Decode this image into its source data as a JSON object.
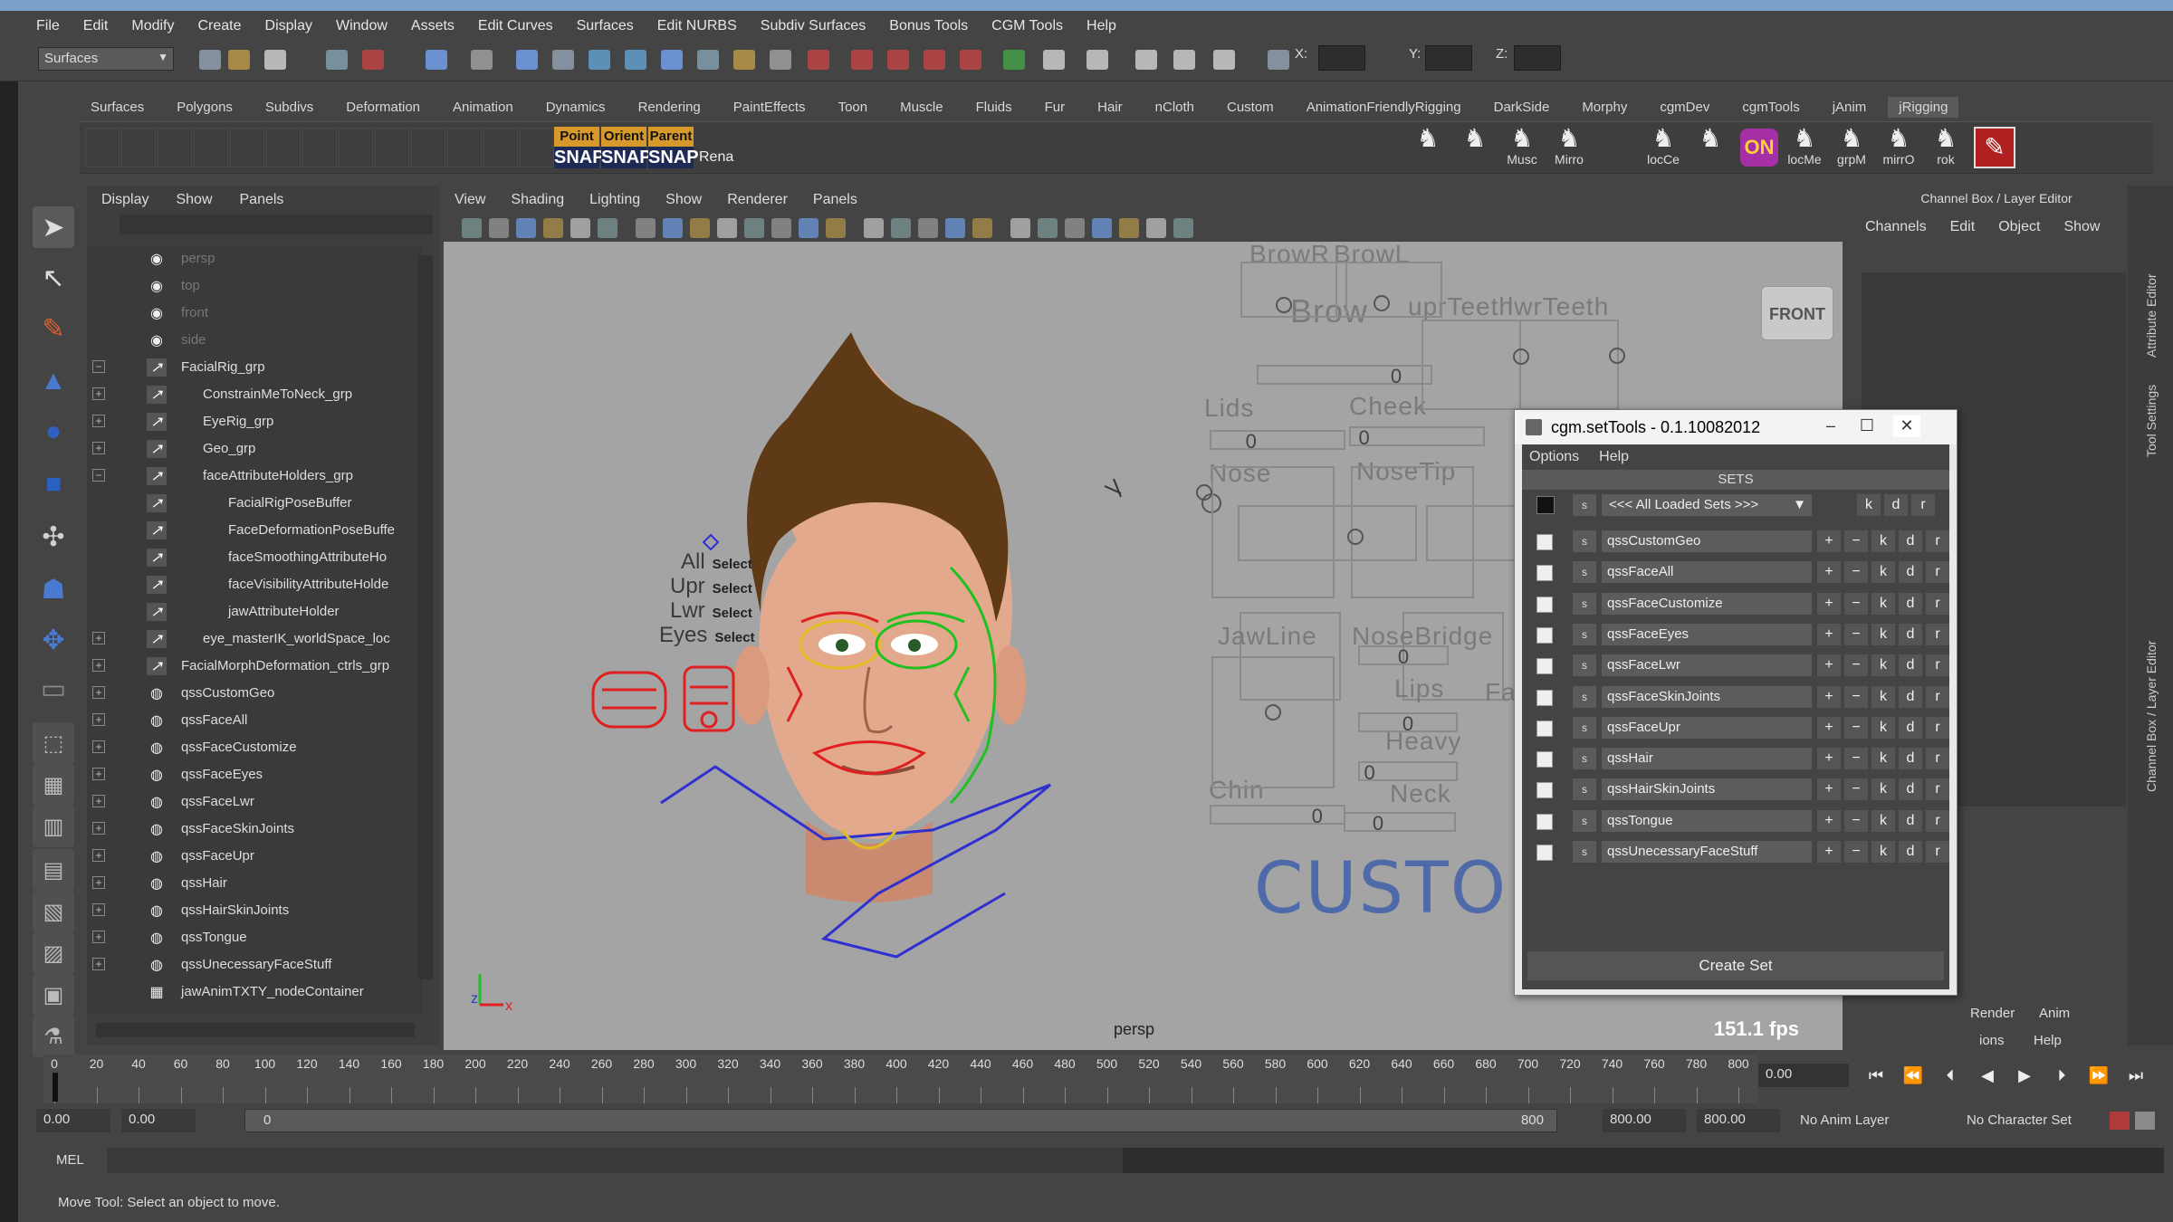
{
  "menubar": [
    "File",
    "Edit",
    "Modify",
    "Create",
    "Display",
    "Window",
    "Assets",
    "Edit Curves",
    "Surfaces",
    "Edit NURBS",
    "Subdiv Surfaces",
    "Bonus Tools",
    "CGM Tools",
    "Help"
  ],
  "status": {
    "mode": "Surfaces",
    "x_label": "X:",
    "y_label": "Y:",
    "z_label": "Z:"
  },
  "shelf_tabs": [
    "Surfaces",
    "Polygons",
    "Subdivs",
    "Deformation",
    "Animation",
    "Dynamics",
    "Rendering",
    "PaintEffects",
    "Toon",
    "Muscle",
    "Fluids",
    "Fur",
    "Hair",
    "nCloth",
    "Custom",
    "AnimationFriendlyRigging",
    "DarkSide",
    "Morphy",
    "cgmDev",
    "cgmTools",
    "jAnim",
    "jRigging"
  ],
  "snap": [
    {
      "top": "Point",
      "bottom": "SNAP"
    },
    {
      "top": "Orient",
      "bottom": "SNAP"
    },
    {
      "top": "Parent",
      "bottom": "SNAP"
    }
  ],
  "shelf_rena": "Rena",
  "shelf_right": [
    {
      "g": "⛓",
      "l": ""
    },
    {
      "g": "⛓",
      "l": ""
    },
    {
      "g": "⛓",
      "l": "Musc"
    },
    {
      "g": "⛓",
      "l": "Mirro"
    },
    {
      "g": "⛓",
      "l": "locCe"
    },
    {
      "g": "⛓",
      "l": ""
    },
    {
      "g": "⛓",
      "l": "locMe"
    },
    {
      "g": "⛓",
      "l": "grpM"
    },
    {
      "g": "⛓",
      "l": "mirrO"
    },
    {
      "g": "⛓",
      "l": "rok"
    }
  ],
  "on_label": "ON",
  "outliner": {
    "menu": [
      "Display",
      "Show",
      "Panels"
    ],
    "rows": [
      {
        "exp": "",
        "icon": "camera-icon",
        "label": "persp",
        "dim": true,
        "indent": 0
      },
      {
        "exp": "",
        "icon": "camera-icon",
        "label": "top",
        "dim": true,
        "indent": 0
      },
      {
        "exp": "",
        "icon": "camera-icon",
        "label": "front",
        "dim": true,
        "indent": 0
      },
      {
        "exp": "",
        "icon": "camera-icon",
        "label": "side",
        "dim": true,
        "indent": 0
      },
      {
        "exp": "−",
        "icon": "transform-icon",
        "label": "FacialRig_grp",
        "dim": false,
        "indent": 0
      },
      {
        "exp": "+",
        "icon": "transform-icon",
        "label": "ConstrainMeToNeck_grp",
        "dim": false,
        "indent": 1
      },
      {
        "exp": "+",
        "icon": "transform-icon",
        "label": "EyeRig_grp",
        "dim": false,
        "indent": 1
      },
      {
        "exp": "+",
        "icon": "transform-icon",
        "label": "Geo_grp",
        "dim": false,
        "indent": 1
      },
      {
        "exp": "−",
        "icon": "transform-icon",
        "label": "faceAttributeHolders_grp",
        "dim": false,
        "indent": 1
      },
      {
        "exp": "",
        "icon": "transform-icon",
        "label": "FacialRigPoseBuffer",
        "dim": false,
        "indent": 2
      },
      {
        "exp": "",
        "icon": "transform-icon",
        "label": "FaceDeformationPoseBuffe",
        "dim": false,
        "indent": 2
      },
      {
        "exp": "",
        "icon": "transform-icon",
        "label": "faceSmoothingAttributeHo",
        "dim": false,
        "indent": 2
      },
      {
        "exp": "",
        "icon": "transform-icon",
        "label": "faceVisibilityAttributeHolde",
        "dim": false,
        "indent": 2
      },
      {
        "exp": "",
        "icon": "transform-icon",
        "label": "jawAttributeHolder",
        "dim": false,
        "indent": 2
      },
      {
        "exp": "+",
        "icon": "transform-icon",
        "label": "eye_masterIK_worldSpace_loc",
        "dim": false,
        "indent": 1
      },
      {
        "exp": "+",
        "icon": "transform-icon",
        "label": "FacialMorphDeformation_ctrls_grp",
        "dim": false,
        "indent": 0
      },
      {
        "exp": "+",
        "icon": "set-icon",
        "label": "qssCustomGeo",
        "dim": false,
        "indent": 0
      },
      {
        "exp": "+",
        "icon": "set-icon",
        "label": "qssFaceAll",
        "dim": false,
        "indent": 0
      },
      {
        "exp": "+",
        "icon": "set-icon",
        "label": "qssFaceCustomize",
        "dim": false,
        "indent": 0
      },
      {
        "exp": "+",
        "icon": "set-icon",
        "label": "qssFaceEyes",
        "dim": false,
        "indent": 0
      },
      {
        "exp": "+",
        "icon": "set-icon",
        "label": "qssFaceLwr",
        "dim": false,
        "indent": 0
      },
      {
        "exp": "+",
        "icon": "set-icon",
        "label": "qssFaceSkinJoints",
        "dim": false,
        "indent": 0
      },
      {
        "exp": "+",
        "icon": "set-icon",
        "label": "qssFaceUpr",
        "dim": false,
        "indent": 0
      },
      {
        "exp": "+",
        "icon": "set-icon",
        "label": "qssHair",
        "dim": false,
        "indent": 0
      },
      {
        "exp": "+",
        "icon": "set-icon",
        "label": "qssHairSkinJoints",
        "dim": false,
        "indent": 0
      },
      {
        "exp": "+",
        "icon": "set-icon",
        "label": "qssTongue",
        "dim": false,
        "indent": 0
      },
      {
        "exp": "+",
        "icon": "set-icon",
        "label": "qssUnecessaryFaceStuff",
        "dim": false,
        "indent": 0
      },
      {
        "exp": "",
        "icon": "container-icon",
        "label": "jawAnimTXTY_nodeContainer",
        "dim": false,
        "indent": 0
      }
    ]
  },
  "viewport": {
    "menu": [
      "View",
      "Shading",
      "Lighting",
      "Show",
      "Renderer",
      "Panels"
    ],
    "camera": "persp",
    "fps": "151.1 fps",
    "front": "FRONT",
    "custom": "CUSTOMS",
    "panel_labels": {
      "browR": "BrowR",
      "browL": "BrowL",
      "brow": "Brow",
      "lids": "Lids",
      "cheek": "Cheek",
      "nose": "Nose",
      "nosetip": "NoseTip",
      "uprteeth": "uprTeeth",
      "lwrteeth": "lwrTeeth",
      "jawline": "JawLine",
      "nosebridge": "NoseBridge",
      "lips": "Lips",
      "heavy": "Heavy",
      "chin": "Chin",
      "neck": "Neck",
      "fa": "Fa"
    },
    "zero": "0",
    "select_rows": [
      {
        "l": "All",
        "s": "Select"
      },
      {
        "l": "Upr",
        "s": "Select"
      },
      {
        "l": "Lwr",
        "s": "Select"
      },
      {
        "l": "Eyes",
        "s": "Select"
      }
    ],
    "axis_z": "z",
    "axis_x": "x"
  },
  "channelbox": {
    "title": "Channel Box / Layer Editor",
    "menu": [
      "Channels",
      "Edit",
      "Object",
      "Show"
    ],
    "lower_tabs": [
      "Render",
      "Anim"
    ],
    "lower_menu": [
      "ions",
      "Help"
    ]
  },
  "sidetabs": [
    "Attribute Editor",
    "Tool Settings",
    "Channel Box / Layer Editor"
  ],
  "cgm": {
    "title": "cgm.setTools - 0.1.10082012",
    "menu": [
      "Options",
      "Help"
    ],
    "sets_header": "SETS",
    "s": "s",
    "all_sets": "<<< All Loaded Sets >>>",
    "header_btns": [
      "k",
      "d",
      "r"
    ],
    "rows": [
      "qssCustomGeo",
      "qssFaceAll",
      "qssFaceCustomize",
      "qssFaceEyes",
      "qssFaceLwr",
      "qssFaceSkinJoints",
      "qssFaceUpr",
      "qssHair",
      "qssHairSkinJoints",
      "qssTongue",
      "qssUnecessaryFaceStuff"
    ],
    "row_btns": [
      "+",
      "−",
      "k",
      "d",
      "r"
    ],
    "create": "Create Set"
  },
  "timeline": {
    "ticks": [
      "0",
      "20",
      "40",
      "60",
      "80",
      "100",
      "120",
      "140",
      "160",
      "180",
      "200",
      "220",
      "240",
      "260",
      "280",
      "300",
      "320",
      "340",
      "360",
      "380",
      "400",
      "420",
      "440",
      "460",
      "480",
      "500",
      "520",
      "540",
      "560",
      "580",
      "600",
      "620",
      "640",
      "660",
      "680",
      "700",
      "720",
      "740",
      "760",
      "780",
      "800"
    ],
    "current": "0.00"
  },
  "range": {
    "start": "0.00",
    "start2": "0.00",
    "slider_start": "0",
    "slider_end": "800",
    "end": "800.00",
    "end2": "800.00",
    "anim_layer": "No Anim Layer",
    "char_set": "No Character Set"
  },
  "cmd": {
    "mel": "MEL"
  },
  "help": "Move Tool: Select an object to move."
}
